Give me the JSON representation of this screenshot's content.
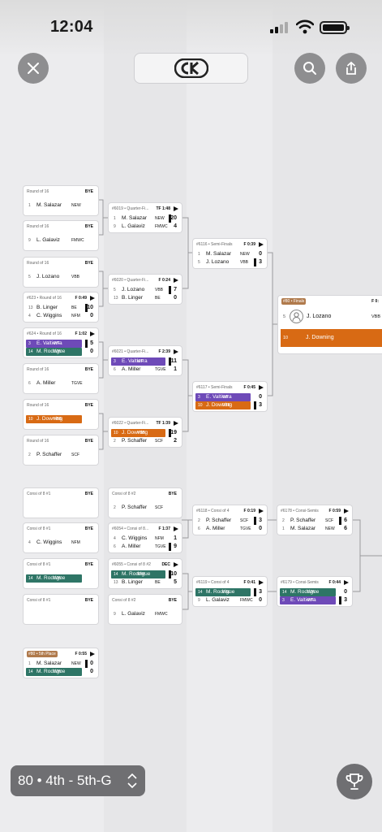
{
  "status": {
    "time": "12:04"
  },
  "columns": [],
  "bracket": {
    "r16": [
      {
        "label": "Round of 16",
        "right": "BYE",
        "rows": [
          {
            "seed": "1",
            "name": "M. Salazar",
            "team": "NEW",
            "score": ""
          }
        ]
      },
      {
        "label": "Round of 16",
        "right": "BYE",
        "rows": [
          {
            "seed": "9",
            "name": "L. Galaviz",
            "team": "FMWC",
            "score": ""
          }
        ]
      },
      {
        "label": "Round of 16",
        "right": "BYE",
        "rows": [
          {
            "seed": "5",
            "name": "J. Lozano",
            "team": "VBB",
            "score": ""
          }
        ]
      },
      {
        "label": "#623 • Round of 16",
        "right": "F 0:49",
        "rows": [
          {
            "seed": "13",
            "name": "B. Linger",
            "team": "BE",
            "score": "10"
          },
          {
            "seed": "4",
            "name": "C. Wiggins",
            "team": "NFM",
            "score": "0"
          }
        ]
      },
      {
        "label": "#624 • Round of 16",
        "right": "F 1:02",
        "rows": [
          {
            "seed": "3",
            "name": "E. Valtierra",
            "team": "WF",
            "score": "5"
          },
          {
            "seed": "14",
            "name": "M. Rodrigue",
            "team": "WW",
            "score": "0"
          }
        ]
      },
      {
        "label": "Round of 16",
        "right": "BYE",
        "rows": [
          {
            "seed": "6",
            "name": "A. Miller",
            "team": "TGVE",
            "score": ""
          }
        ]
      },
      {
        "label": "Round of 16",
        "right": "BYE",
        "rows": [
          {
            "seed": "10",
            "name": "J. Downing",
            "team": "VBB",
            "score": ""
          }
        ]
      },
      {
        "label": "Round of 16",
        "right": "BYE",
        "rows": [
          {
            "seed": "2",
            "name": "P. Schaffer",
            "team": "SCF",
            "score": ""
          }
        ]
      }
    ],
    "qf": [
      {
        "label": "#6019 • Quarter-Fi...",
        "right": "TF 1:48",
        "rows": [
          {
            "seed": "1",
            "name": "M. Salazar",
            "team": "NEW",
            "score": "20"
          },
          {
            "seed": "9",
            "name": "L. Galaviz",
            "team": "FMWC",
            "score": "4"
          }
        ]
      },
      {
        "label": "#6020 • Quarter-Fi...",
        "right": "F 0:24",
        "rows": [
          {
            "seed": "5",
            "name": "J. Lozano",
            "team": "VBB",
            "score": "7"
          },
          {
            "seed": "13",
            "name": "B. Linger",
            "team": "BE",
            "score": "0"
          }
        ]
      },
      {
        "label": "#6021 • Quarter-Fi...",
        "right": "F 2:39",
        "rows": [
          {
            "seed": "3",
            "name": "E. Valtierra",
            "team": "WF",
            "score": "11"
          },
          {
            "seed": "6",
            "name": "A. Miller",
            "team": "TGVE",
            "score": "1"
          }
        ]
      },
      {
        "label": "#6022 • Quarter-Fi...",
        "right": "TF 1:39",
        "rows": [
          {
            "seed": "10",
            "name": "J. Downing",
            "team": "VBB",
            "score": "19"
          },
          {
            "seed": "2",
            "name": "P. Schaffer",
            "team": "SCF",
            "score": "2"
          }
        ]
      }
    ],
    "sf": [
      {
        "label": "#6116 • Semi-Finals",
        "right": "F 0:39",
        "rows": [
          {
            "seed": "1",
            "name": "M. Salazar",
            "team": "NEW",
            "score": "0"
          },
          {
            "seed": "5",
            "name": "J. Lozano",
            "team": "VBB",
            "score": "3"
          }
        ]
      },
      {
        "label": "#6117 • Semi-Finals",
        "right": "F 0:45",
        "rows": [
          {
            "seed": "3",
            "name": "E. Valtierra",
            "team": "WF",
            "score": "0"
          },
          {
            "seed": "10",
            "name": "J. Downing",
            "team": "VBB",
            "score": "3"
          }
        ]
      }
    ],
    "final": {
      "tag": "#80 • Finals",
      "right": "F 0:",
      "rows": [
        {
          "seed": "5",
          "name": "J. Lozano",
          "team": "VBB"
        },
        {
          "seed": "10",
          "name": "J. Downing",
          "team": ""
        }
      ]
    },
    "consi8a": [
      {
        "label": "Consi of 8 #1",
        "right": "BYE",
        "rows": []
      },
      {
        "label": "Consi of 8 #1",
        "right": "BYE",
        "rows": [
          {
            "seed": "4",
            "name": "C. Wiggins",
            "team": "NFM",
            "score": ""
          }
        ]
      },
      {
        "label": "Consi of 8 #1",
        "right": "BYE",
        "rows": [
          {
            "seed": "14",
            "name": "M. Rodrigue",
            "team": "WW",
            "score": ""
          }
        ]
      },
      {
        "label": "Consi of 8 #1",
        "right": "BYE",
        "rows": []
      }
    ],
    "consi8b": [
      {
        "label": "Consi of 8 #2",
        "right": "BYE",
        "rows": [
          {
            "seed": "2",
            "name": "P. Schaffer",
            "team": "SCF",
            "score": ""
          }
        ]
      },
      {
        "label": "#6054 • Consi of 8...",
        "right": "F 1:37",
        "rows": [
          {
            "seed": "4",
            "name": "C. Wiggins",
            "team": "NFM",
            "score": "1"
          },
          {
            "seed": "6",
            "name": "A. Miller",
            "team": "TGVE",
            "score": "9"
          }
        ]
      },
      {
        "label": "#6055 • Consi of 8 #2",
        "right": "DEC",
        "rows": [
          {
            "seed": "14",
            "name": "M. Rodrigue",
            "team": "WW",
            "score": "10"
          },
          {
            "seed": "13",
            "name": "B. Linger",
            "team": "BE",
            "score": "5"
          }
        ]
      },
      {
        "label": "Consi of 8 #2",
        "right": "BYE",
        "rows": [
          {
            "seed": "9",
            "name": "L. Galaviz",
            "team": "FMWC",
            "score": ""
          }
        ]
      }
    ],
    "consi4": [
      {
        "label": "#6118 • Consi of 4",
        "right": "F 0:19",
        "rows": [
          {
            "seed": "2",
            "name": "P. Schaffer",
            "team": "SCF",
            "score": "3"
          },
          {
            "seed": "6",
            "name": "A. Miller",
            "team": "TGVE",
            "score": "0"
          }
        ]
      },
      {
        "label": "#6119 • Consi of 4",
        "right": "F 0:41",
        "rows": [
          {
            "seed": "14",
            "name": "M. Rodrigue",
            "team": "WW",
            "score": "3"
          },
          {
            "seed": "9",
            "name": "L. Galaviz",
            "team": "FMWC",
            "score": "0"
          }
        ]
      }
    ],
    "consisemi": [
      {
        "label": "#6178 • Consi-Semis",
        "right": "F 0:59",
        "rows": [
          {
            "seed": "2",
            "name": "P. Schaffer",
            "team": "SCF",
            "score": "6"
          },
          {
            "seed": "1",
            "name": "M. Salazar",
            "team": "NEW",
            "score": "6"
          }
        ]
      },
      {
        "label": "#6179 • Consi-Semis",
        "right": "F 0:44",
        "rows": [
          {
            "seed": "14",
            "name": "M. Rodrigue",
            "team": "WW",
            "score": "0"
          },
          {
            "seed": "3",
            "name": "E. Valtierra",
            "team": "WF",
            "score": "3"
          }
        ]
      }
    ],
    "fifth": {
      "tag": "#80 • 5th Place",
      "right": "F 0:55",
      "rows": [
        {
          "seed": "1",
          "name": "M. Salazar",
          "team": "NEW",
          "score": "0"
        },
        {
          "seed": "14",
          "name": "M. Rodrigue",
          "team": "WW",
          "score": "0"
        }
      ]
    }
  },
  "bottom": {
    "label": "80 • 4th - 5th-G"
  },
  "colors": {
    "purple": "#6e4ab8",
    "green": "#2e7566",
    "orange": "#d86a14",
    "tag": "#b07a4c"
  }
}
